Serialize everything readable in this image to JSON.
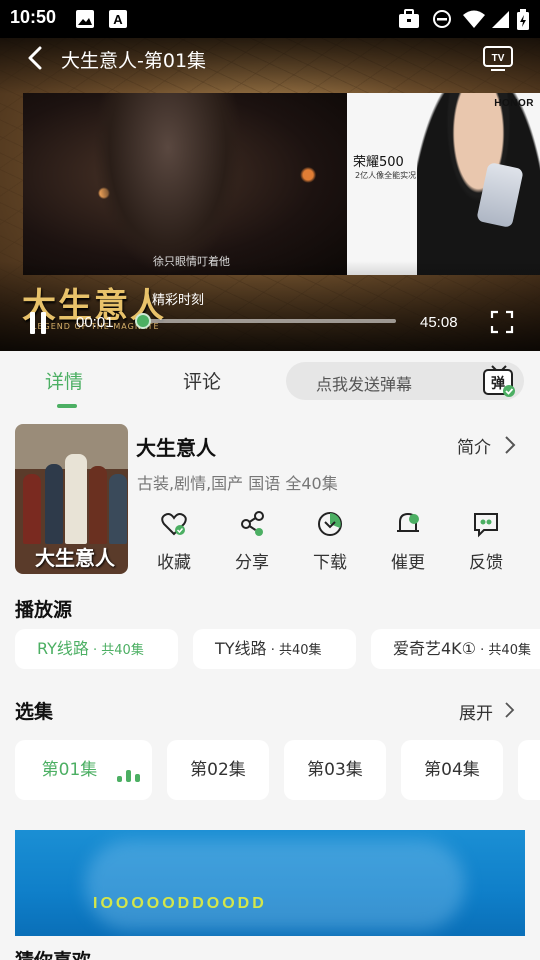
{
  "status_bar": {
    "time": "10:50",
    "left_icons": [
      "image-icon",
      "text-a-icon"
    ],
    "right_icons": [
      "briefcase-icon",
      "do-not-disturb-icon",
      "wifi-icon",
      "signal-icon",
      "battery-charging-icon"
    ]
  },
  "player": {
    "title": "大生意人-第01集",
    "logo_text": "大生意人",
    "logo_sub": "LEGEND OF THE MAGNATE",
    "subtitle": "徐只眼情叮着他",
    "highlight_label": "精彩时刻",
    "current_time": "00:01",
    "total_time": "45:08",
    "progress": 0.02,
    "ad": {
      "brand": "HONOR",
      "model": "荣耀500",
      "slogan": "2亿人像全能实况"
    }
  },
  "tabs": {
    "detail": "详情",
    "comment": "评论",
    "danmaku_placeholder": "点我发送弹幕",
    "danmaku_icon_label": "弹"
  },
  "show": {
    "poster_title": "大生意人",
    "title": "大生意人",
    "intro_label": "简介",
    "meta": "古装,剧情,国产 国语 全40集",
    "actions": [
      {
        "label": "收藏",
        "icon": "heart-icon"
      },
      {
        "label": "分享",
        "icon": "share-icon"
      },
      {
        "label": "下载",
        "icon": "download-icon"
      },
      {
        "label": "催更",
        "icon": "bell-icon"
      },
      {
        "label": "反馈",
        "icon": "feedback-icon"
      }
    ]
  },
  "sources": {
    "title": "播放源",
    "items": [
      {
        "name": "RY线路",
        "count": " · 共40集",
        "active": true
      },
      {
        "name": "TY线路",
        "count": " · 共40集",
        "active": false
      },
      {
        "name": "爱奇艺4K①",
        "count": " · 共40集",
        "active": false
      }
    ]
  },
  "episodes": {
    "title": "选集",
    "expand_label": "展开",
    "items": [
      {
        "label": "第01集",
        "active": true
      },
      {
        "label": "第02集",
        "active": false
      },
      {
        "label": "第03集",
        "active": false
      },
      {
        "label": "第04集",
        "active": false
      }
    ]
  },
  "banner": {
    "text": "IOOOOODDOODD"
  },
  "next_section_title": "猜你喜欢",
  "colors": {
    "accent": "#4caf63",
    "background": "#f5f5f5"
  }
}
